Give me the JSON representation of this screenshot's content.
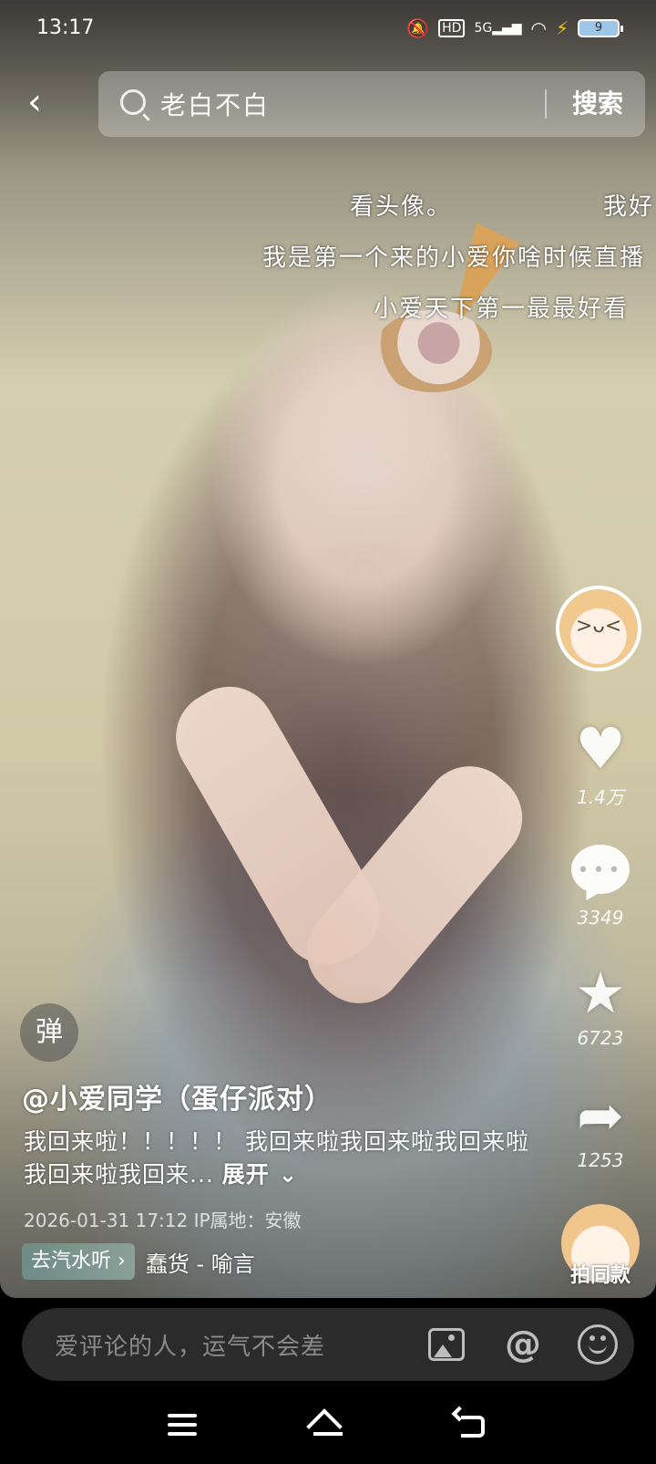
{
  "status_bar": {
    "time": "13:17",
    "icons": [
      "mute-icon",
      "hd-icon",
      "5g-signal-icon",
      "wifi-icon",
      "charging-icon"
    ],
    "battery_level": "9"
  },
  "header": {
    "search_placeholder": "老白不白",
    "search_button": "搜索"
  },
  "danmaku": [
    "看头像。",
    "我好",
    "我是第一个来的小爱你啥时候直播",
    "小爱天下第一最最好看"
  ],
  "actions": {
    "like_count": "1.4万",
    "comment_count": "3349",
    "favorite_count": "6723",
    "share_count": "1253",
    "same_style_label": "拍同款"
  },
  "post": {
    "danmaku_toggle": "弹",
    "author": "@小爱同学（蛋仔派对）",
    "description": "我回来啦！！！！！ 我回来啦我回来啦我回来啦我回来啦我回来...",
    "expand_label": "展开",
    "meta": "2026-01-31 17:12  IP属地：安徽",
    "music_tag": "去汽水听",
    "song": "蠢货 - 喻言"
  },
  "comment_bar": {
    "placeholder": "爱评论的人，运气不会差"
  },
  "colors": {
    "comment_bar_bg": "#2b2b2b",
    "music_tag_bg": "#7a948e"
  }
}
